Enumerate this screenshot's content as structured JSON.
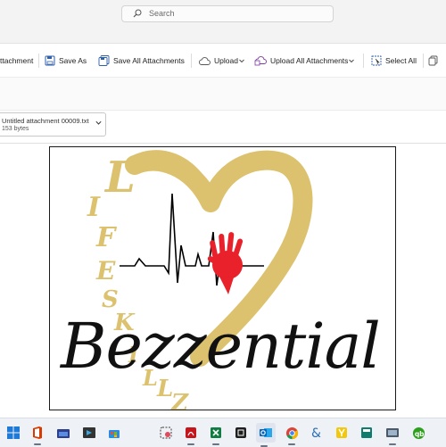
{
  "search": {
    "placeholder": "Search"
  },
  "toolbar": {
    "attachment_partial": "ttachment",
    "save_as": "Save As",
    "save_all": "Save All Attachments",
    "upload": "Upload",
    "upload_all": "Upload All Attachments",
    "select_all": "Select All"
  },
  "attachment": {
    "name": "Untitled attachment 00009.txt",
    "size": "153 bytes"
  },
  "logo": {
    "vertical_word": [
      "L",
      "I",
      "F",
      "E",
      "S",
      "K",
      "I",
      "L",
      "L",
      "Z"
    ],
    "brand": "Bezzential",
    "colors": {
      "heart": "#dcc26e",
      "hand": "#e8212a",
      "text": "#111111",
      "ecg": "#000000"
    }
  },
  "taskbar": {
    "icons": [
      "windows-start-icon",
      "office-icon",
      "store-icon",
      "tablet-app-icon",
      "remote-app-icon",
      "store-bag-icon",
      "snipping-tool-icon",
      "pdf-reader-icon",
      "excel-icon",
      "terminal-icon",
      "outlook-icon",
      "chrome-icon",
      "ampersand-app-icon",
      "yammer-icon",
      "calculator-icon",
      "quickbooks-icon"
    ]
  }
}
